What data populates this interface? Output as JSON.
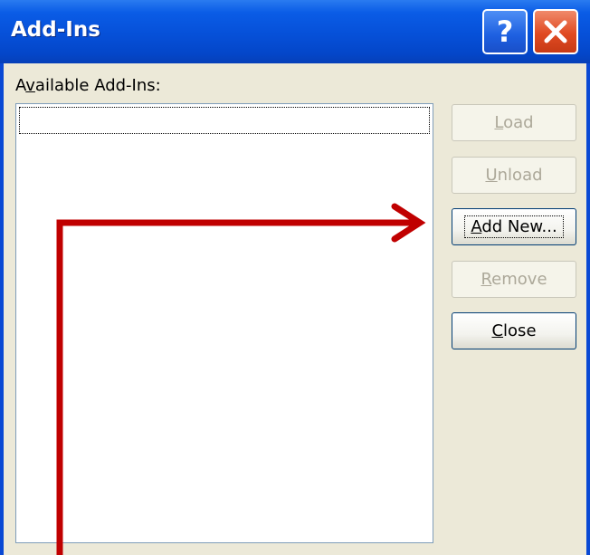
{
  "window": {
    "title": "Add-Ins"
  },
  "title_buttons": {
    "help_glyph": "?",
    "close_icon": "close-x-icon"
  },
  "list": {
    "label_pre": "A",
    "label_ul": "v",
    "label_post": "ailable Add-Ins:",
    "items": []
  },
  "buttons": {
    "load": {
      "pre": "",
      "ul": "L",
      "post": "oad",
      "enabled": false
    },
    "unload": {
      "pre": "",
      "ul": "U",
      "post": "nload",
      "enabled": false
    },
    "add_new": {
      "pre": "",
      "ul": "A",
      "post": "dd New...",
      "enabled": true,
      "focused": true
    },
    "remove": {
      "pre": "",
      "ul": "R",
      "post": "emove",
      "enabled": false
    },
    "close": {
      "pre": "",
      "ul": "C",
      "post": "lose",
      "enabled": true
    }
  },
  "annotation": {
    "color": "#c00000",
    "icon": "annotation-arrow-icon"
  },
  "colors": {
    "title_bar": "#0650d8",
    "dialog_bg": "#ece9d8",
    "disabled_text": "#aca899"
  }
}
